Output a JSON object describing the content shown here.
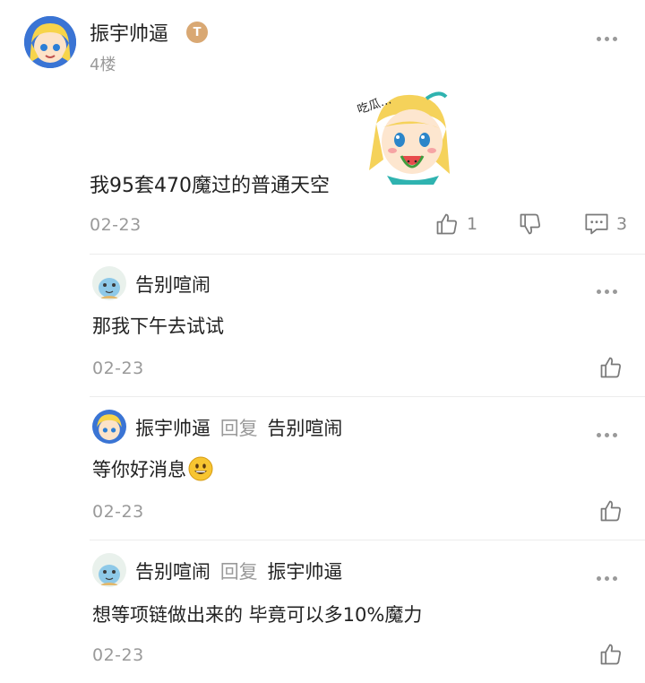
{
  "main_post": {
    "author": "振宇帅逼",
    "author_badge": "T",
    "floor": "4楼",
    "content": "我95套470魔过的普通天空",
    "sticker_text": "吃瓜…",
    "date": "02-23",
    "like_count": "1",
    "comment_count": "3"
  },
  "replies": [
    {
      "author": "告别喧闹",
      "reply_label": "",
      "reply_to": "",
      "content": "那我下午去试试",
      "date": "02-23"
    },
    {
      "author": "振宇帅逼",
      "reply_label": "回复",
      "reply_to": "告别喧闹",
      "content": "等你好消息",
      "date": "02-23"
    },
    {
      "author": "告别喧闹",
      "reply_label": "回复",
      "reply_to": "振宇帅逼",
      "content": "想等项链做出来的 毕竟可以多10%魔力",
      "date": "02-23"
    }
  ],
  "colors": {
    "muted": "#9a9a9a",
    "badge": "#d9a873",
    "divider": "#ececec"
  }
}
